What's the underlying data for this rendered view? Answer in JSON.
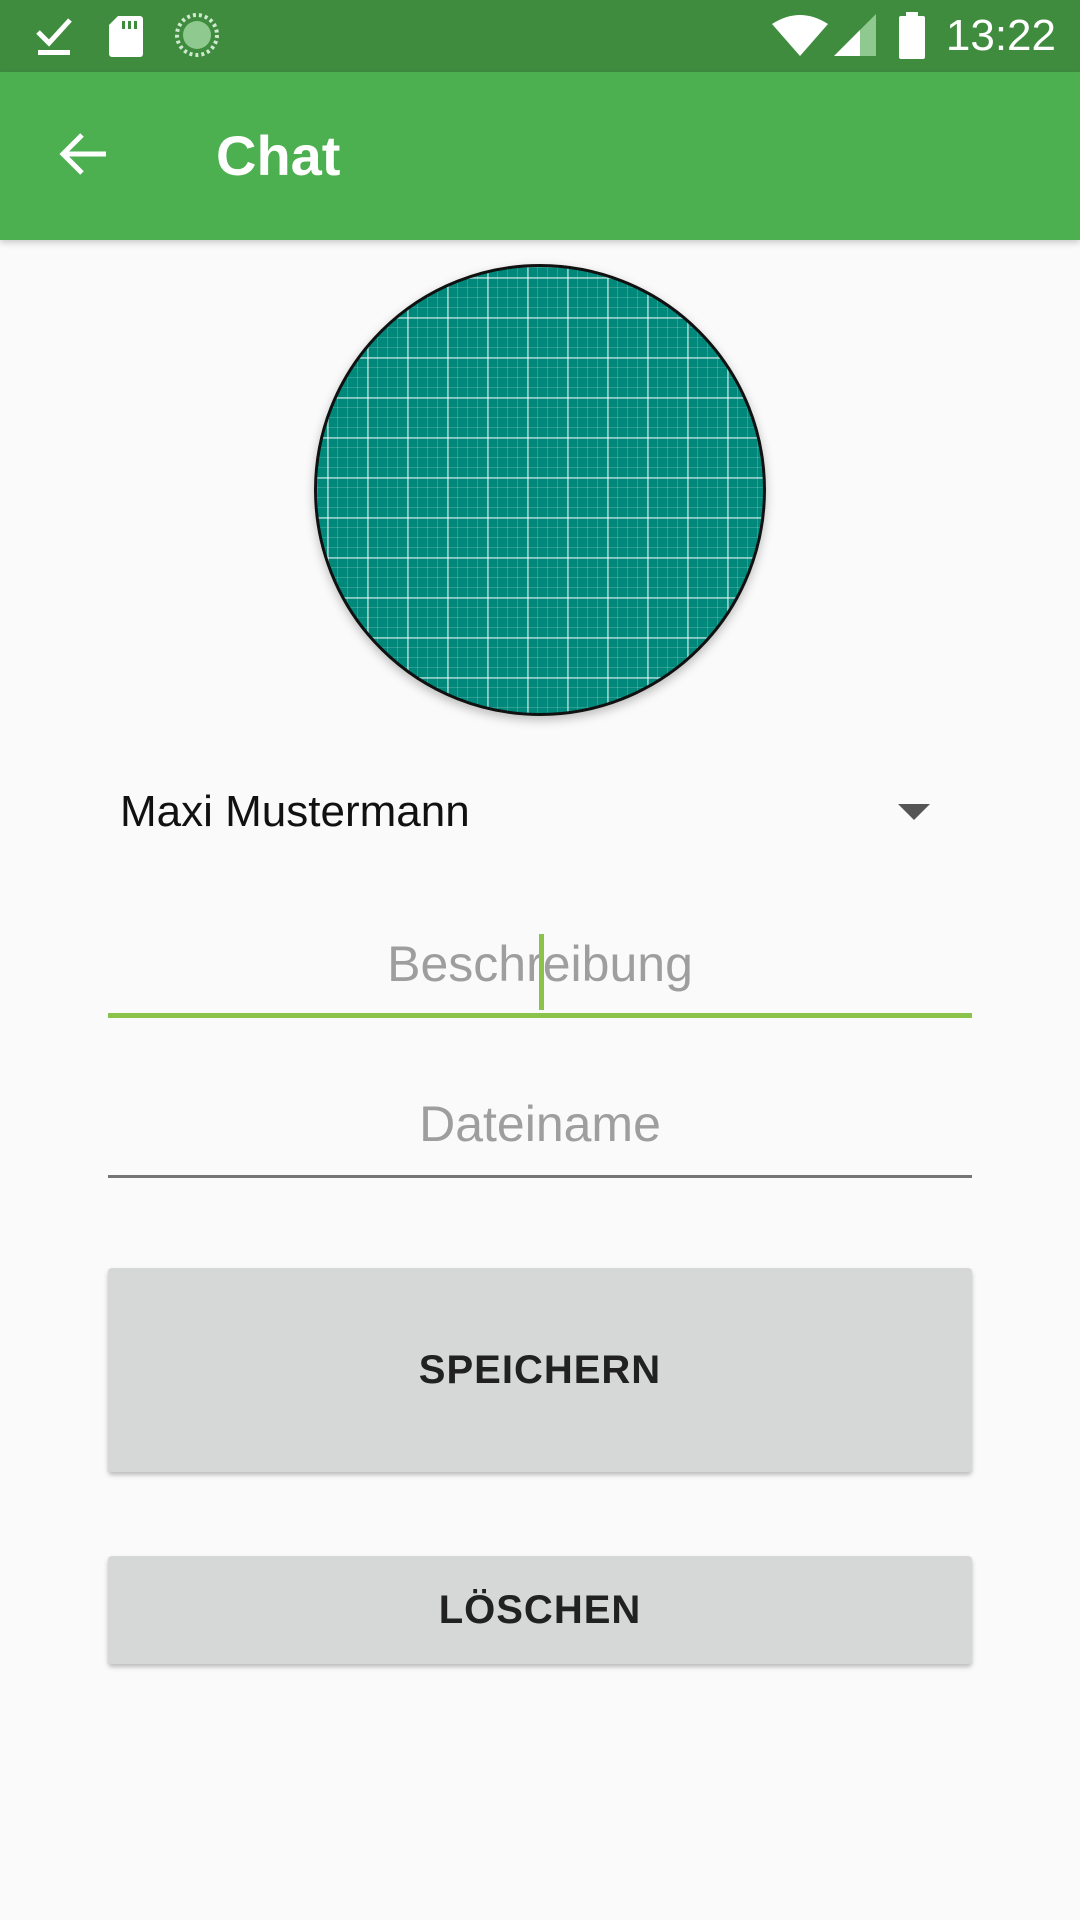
{
  "status_bar": {
    "time": "13:22",
    "left_icons": [
      "download-done-icon",
      "sd-card-icon",
      "sync-progress-icon"
    ],
    "right_icons": [
      "wifi-icon",
      "cell-signal-icon",
      "battery-icon"
    ]
  },
  "app_bar": {
    "title": "Chat",
    "back_icon": "arrow-back-icon"
  },
  "avatar": {
    "description_icon": "grid-placeholder-image"
  },
  "contact_spinner": {
    "selected": "Maxi Mustermann"
  },
  "form": {
    "description_placeholder": "Beschreibung",
    "filename_placeholder": "Dateiname"
  },
  "buttons": {
    "save_label": "SPEICHERN",
    "delete_label": "LÖSCHEN"
  },
  "colors": {
    "status_bar": "#3f8c3f",
    "app_bar": "#4caf50",
    "accent": "#8bc34a",
    "avatar_fill": "#00897b",
    "button_bg": "#d6d7d7"
  }
}
